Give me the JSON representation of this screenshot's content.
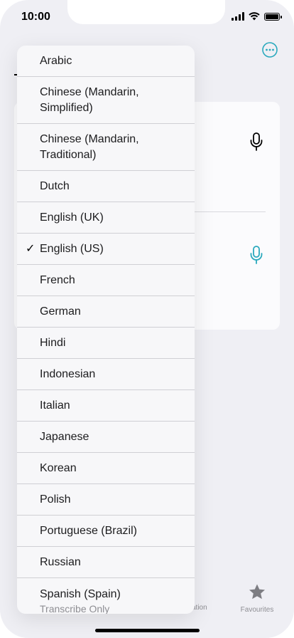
{
  "status": {
    "time": "10:00"
  },
  "menu": {
    "items": [
      {
        "label": "Arabic",
        "checked": false
      },
      {
        "label": "Chinese (Mandarin, Simplified)",
        "checked": false
      },
      {
        "label": "Chinese (Mandarin, Traditional)",
        "checked": false
      },
      {
        "label": "Dutch",
        "checked": false
      },
      {
        "label": "English (UK)",
        "checked": false
      },
      {
        "label": "English (US)",
        "checked": true
      },
      {
        "label": "French",
        "checked": false
      },
      {
        "label": "German",
        "checked": false
      },
      {
        "label": "Hindi",
        "checked": false
      },
      {
        "label": "Indonesian",
        "checked": false
      },
      {
        "label": "Italian",
        "checked": false
      },
      {
        "label": "Japanese",
        "checked": false
      },
      {
        "label": "Korean",
        "checked": false
      },
      {
        "label": "Polish",
        "checked": false
      },
      {
        "label": "Portuguese (Brazil)",
        "checked": false
      },
      {
        "label": "Russian",
        "checked": false
      },
      {
        "label": "Spanish (Spain)",
        "checked": false,
        "sublabel": "Transcribe Only"
      }
    ],
    "check_glyph": "✓"
  },
  "tabbar": {
    "partial_label": "ation",
    "favourites_label": "Favourites"
  },
  "colors": {
    "accent": "#2aa9bd",
    "background": "#efeff4"
  }
}
